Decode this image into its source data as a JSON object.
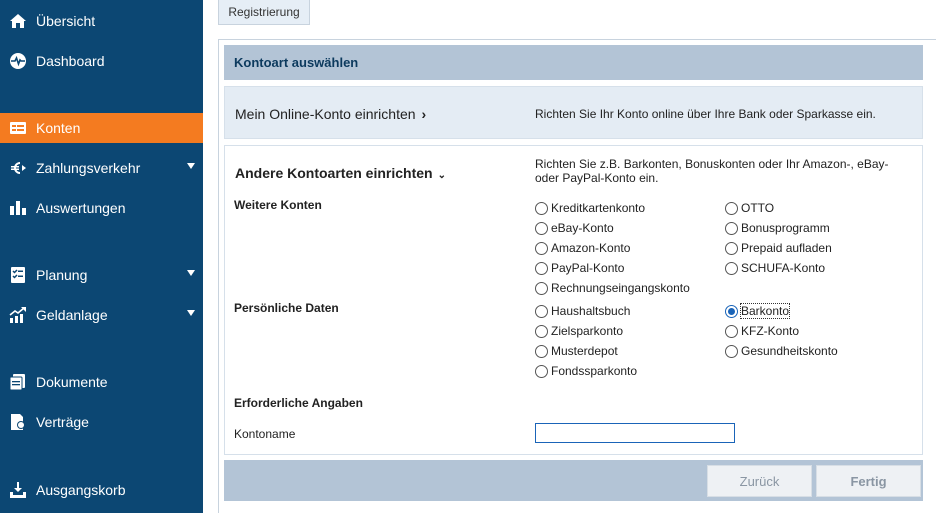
{
  "sidebar": {
    "items": [
      {
        "label": "Übersicht",
        "icon": "home-icon"
      },
      {
        "label": "Dashboard",
        "icon": "pulse-icon"
      },
      {
        "label": "Konten",
        "icon": "accounts-icon",
        "active": true
      },
      {
        "label": "Zahlungsverkehr",
        "icon": "euro-transfer-icon",
        "has_submenu": true
      },
      {
        "label": "Auswertungen",
        "icon": "bar-chart-icon"
      },
      {
        "label": "Planung",
        "icon": "checklist-icon",
        "has_submenu": true
      },
      {
        "label": "Geldanlage",
        "icon": "growth-chart-icon",
        "has_submenu": true
      },
      {
        "label": "Dokumente",
        "icon": "documents-icon"
      },
      {
        "label": "Verträge",
        "icon": "contract-icon"
      },
      {
        "label": "Ausgangskorb",
        "icon": "outbox-icon"
      }
    ]
  },
  "tab": {
    "label": "Registrierung"
  },
  "header": {
    "title": "Kontoart auswählen"
  },
  "online": {
    "link_label": "Mein Online-Konto einrichten",
    "description": "Richten Sie Ihr Konto online über Ihre Bank oder Sparkasse ein."
  },
  "other": {
    "title": "Andere Kontoarten einrichten",
    "description": "Richten Sie z.B. Barkonten, Bonuskonten oder Ihr Amazon-, eBay- oder PayPal-Konto ein.",
    "weitere_label": "Weitere Konten",
    "weitere_options": {
      "col1": [
        "Kreditkartenkonto",
        "eBay-Konto",
        "Amazon-Konto",
        "PayPal-Konto",
        "Rechnungseingangskonto"
      ],
      "col2": [
        "OTTO",
        "Bonusprogramm",
        "Prepaid aufladen",
        "SCHUFA-Konto"
      ]
    },
    "persoenlich_label": "Persönliche Daten",
    "persoenlich_options": {
      "col1": [
        "Haushaltsbuch",
        "Zielsparkonto",
        "Musterdepot",
        "Fondssparkonto"
      ],
      "col2": [
        "Barkonto",
        "KFZ-Konto",
        "Gesundheitskonto"
      ]
    },
    "selected": "Barkonto",
    "erforderlich_label": "Erforderliche Angaben",
    "kontoname_label": "Kontoname",
    "kontoname_value": ""
  },
  "footer": {
    "back_label": "Zurück",
    "done_label": "Fertig"
  },
  "colors": {
    "sidebar_bg": "#0c4773",
    "active": "#f47b20",
    "header_bg": "#b3c4d6",
    "selected_radio": "#1a64b8"
  }
}
